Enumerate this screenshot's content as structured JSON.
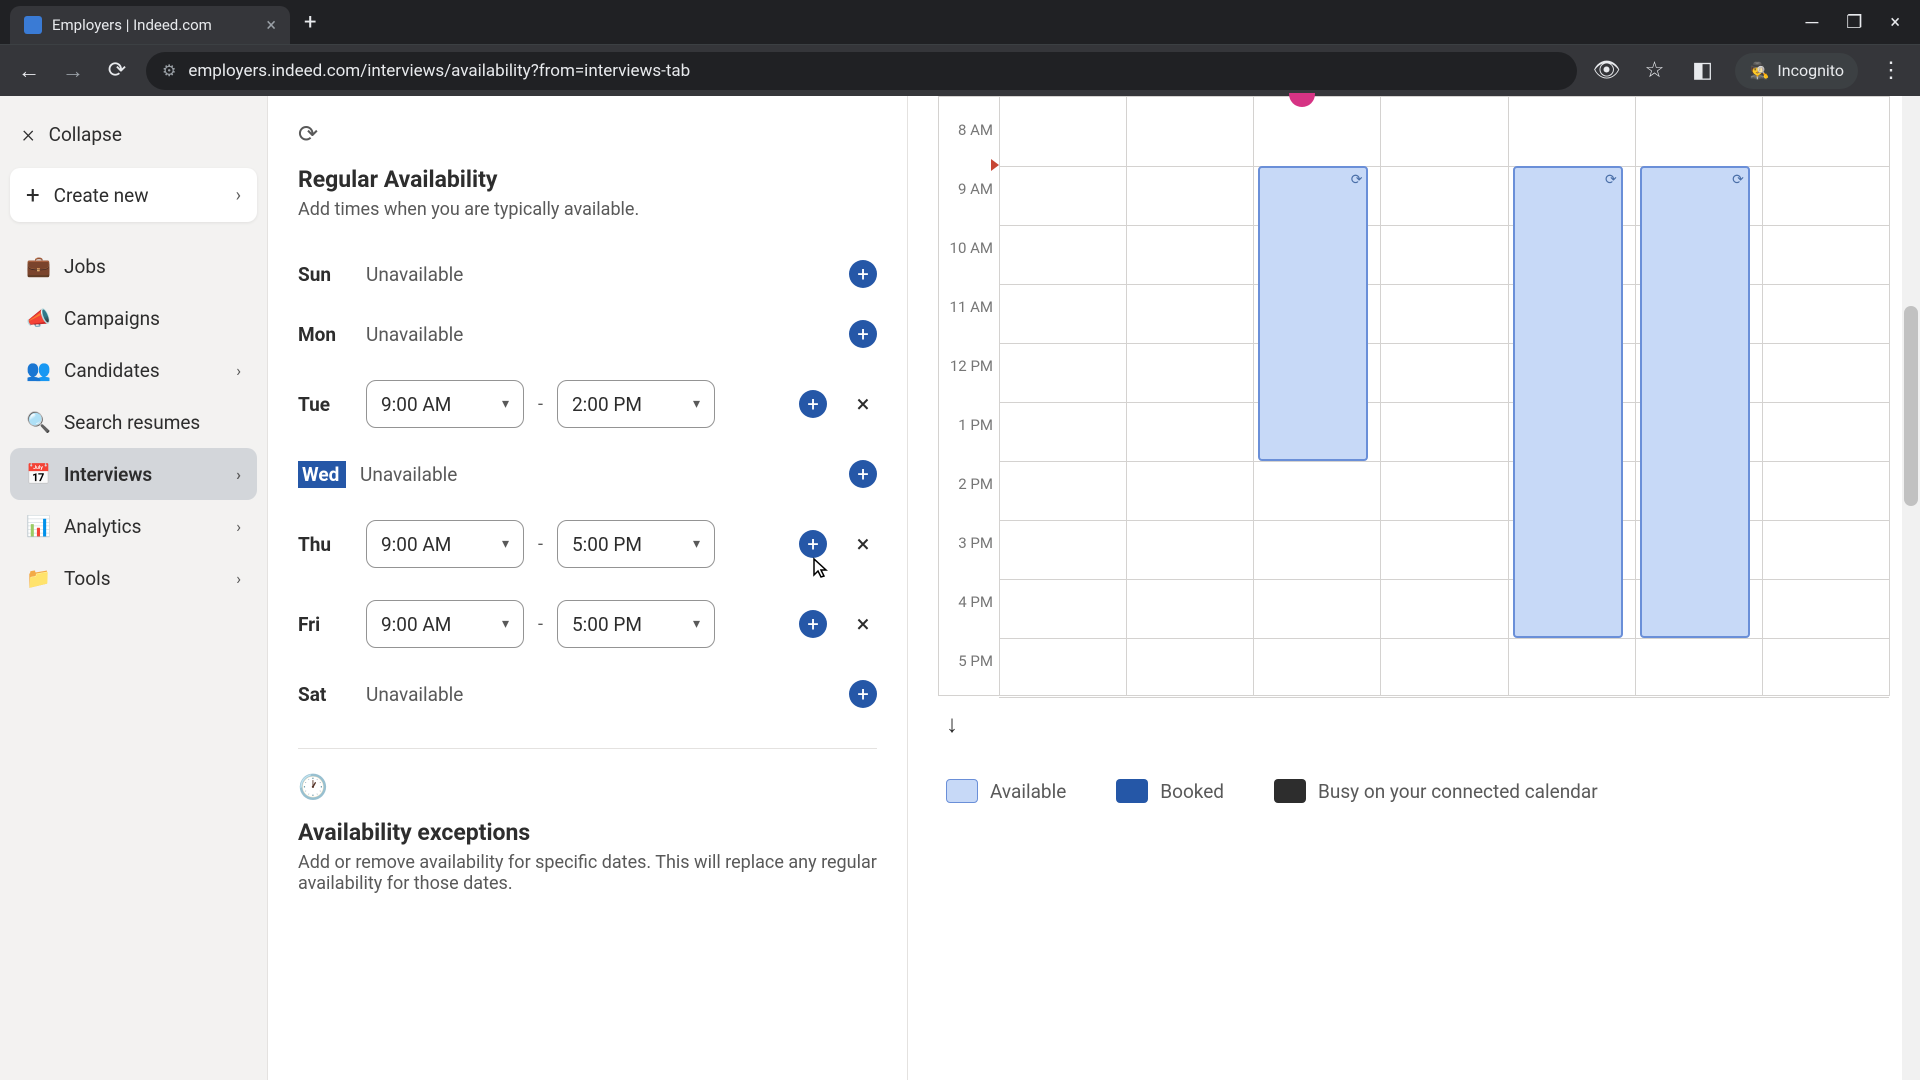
{
  "browser": {
    "tab_title": "Employers | Indeed.com",
    "url": "employers.indeed.com/interviews/availability?from=interviews-tab",
    "incognito_label": "Incognito"
  },
  "sidebar": {
    "collapse": "Collapse",
    "create_new": "Create new",
    "items": [
      {
        "label": "Jobs",
        "icon": "💼",
        "chev": false
      },
      {
        "label": "Campaigns",
        "icon": "📣",
        "chev": false
      },
      {
        "label": "Candidates",
        "icon": "👥",
        "chev": true
      },
      {
        "label": "Search resumes",
        "icon": "🔍",
        "chev": false
      },
      {
        "label": "Interviews",
        "icon": "📅",
        "chev": true,
        "active": true
      },
      {
        "label": "Analytics",
        "icon": "📊",
        "chev": true
      },
      {
        "label": "Tools",
        "icon": "📁",
        "chev": true
      }
    ]
  },
  "availability": {
    "section_title": "Regular Availability",
    "section_sub": "Add times when you are typically available.",
    "unavailable_label": "Unavailable",
    "days": [
      {
        "name": "Sun",
        "unavailable": true
      },
      {
        "name": "Mon",
        "unavailable": true
      },
      {
        "name": "Tue",
        "start": "9:00 AM",
        "end": "2:00 PM"
      },
      {
        "name": "Wed",
        "unavailable": true,
        "highlighted": true
      },
      {
        "name": "Thu",
        "start": "9:00 AM",
        "end": "5:00 PM"
      },
      {
        "name": "Fri",
        "start": "9:00 AM",
        "end": "5:00 PM"
      },
      {
        "name": "Sat",
        "unavailable": true
      }
    ],
    "exceptions_title": "Availability exceptions",
    "exceptions_sub": "Add or remove availability for specific dates. This will replace any regular availability for those dates."
  },
  "calendar": {
    "hours": [
      "8 AM",
      "9 AM",
      "10 AM",
      "11 AM",
      "12 PM",
      "1 PM",
      "2 PM",
      "3 PM",
      "4 PM",
      "5 PM"
    ],
    "legend": {
      "available": "Available",
      "booked": "Booked",
      "busy": "Busy on your connected calendar"
    }
  }
}
